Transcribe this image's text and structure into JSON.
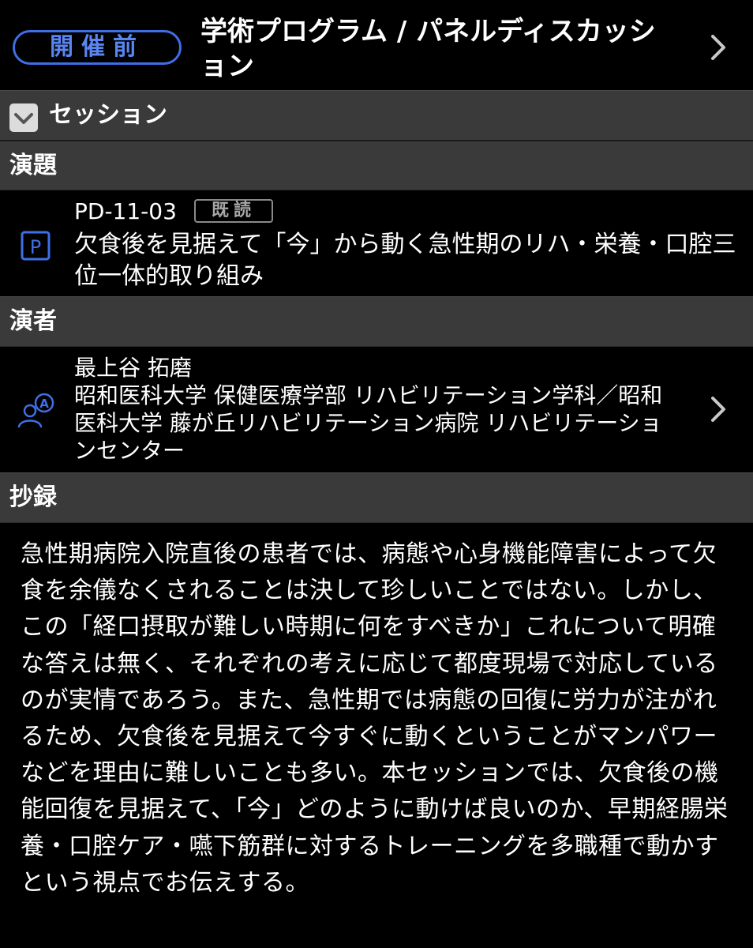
{
  "header": {
    "status": "開催前",
    "title": "学術プログラム / パネルディスカッション"
  },
  "session_bar": {
    "label": "セッション",
    "checked": true
  },
  "talk_section": {
    "label": "演題",
    "code": "PD-11-03",
    "read_badge": "既読",
    "title": "欠食後を見据えて「今」から動く急性期のリハ・栄養・口腔三位一体的取り組み"
  },
  "speaker_section": {
    "label": "演者",
    "name": "最上谷 拓磨",
    "affiliation": "昭和医科大学 保健医療学部 リハビリテーション学科／昭和医科大学 藤が丘リハビリテーション病院 リハビリテーションセンター"
  },
  "abstract_section": {
    "label": "抄録",
    "text": "急性期病院入院直後の患者では、病態や心身機能障害によって欠食を余儀なくされることは決して珍しいことではない。しかし、この「経口摂取が難しい時期に何をすべきか」これについて明確な答えは無く、それぞれの考えに応じて都度現場で対応しているのが実情であろう。また、急性期では病態の回復に労力が注がれるため、欠食後を見据えて今すぐに動くということがマンパワーなどを理由に難しいことも多い。本セッションでは、欠食後の機能回復を見据えて、「今」どのように動けば良いのか、早期経腸栄養・口腔ケア・嚥下筋群に対するトレーニングを多職種で動かすという視点でお伝えする。"
  },
  "colors": {
    "accent": "#3f6fe6",
    "bar": "#3a3a3a",
    "background": "#000000"
  }
}
